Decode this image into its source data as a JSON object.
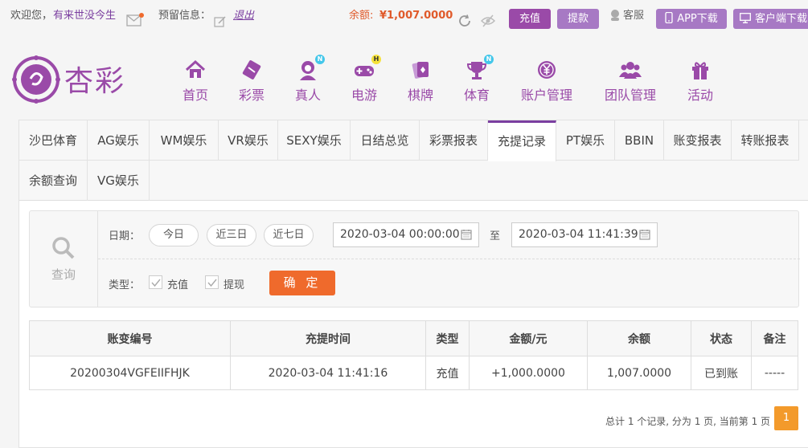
{
  "topbar": {
    "welcome": "欢迎您，",
    "username": "有来世没今生",
    "maintenance_label": "预留信息：",
    "logout": "退出",
    "balance_label": "余额:",
    "balance_value": "¥1,007.0000",
    "deposit": "充值",
    "withdraw": "提款",
    "customer_service": "客服",
    "app_download": "APP下载",
    "client_download": "客户端下载",
    "accent": "#9a4aa8"
  },
  "brand": {
    "logo_text": "杏彩"
  },
  "nav": [
    {
      "label": "首页",
      "icon": "home-icon"
    },
    {
      "label": "彩票",
      "icon": "ticket-icon"
    },
    {
      "label": "真人",
      "icon": "live-dealer-icon",
      "badge": "N"
    },
    {
      "label": "电游",
      "icon": "gamepad-icon",
      "badge": "H"
    },
    {
      "label": "棋牌",
      "icon": "cards-icon"
    },
    {
      "label": "体育",
      "icon": "trophy-icon",
      "badge": "N"
    },
    {
      "label": "账户管理",
      "icon": "yen-coin-icon"
    },
    {
      "label": "团队管理",
      "icon": "team-icon"
    },
    {
      "label": "活动",
      "icon": "gift-icon"
    }
  ],
  "tabs": [
    "沙巴体育",
    "AG娱乐",
    "WM娱乐",
    "VR娱乐",
    "SEXY娱乐",
    "日结总览",
    "彩票报表",
    "充提记录",
    "PT娱乐",
    "BBIN",
    "账变报表",
    "转账报表",
    "余额查询",
    "VG娱乐"
  ],
  "active_tab": "充提记录",
  "filter": {
    "query_label": "查询",
    "date_label": "日期：",
    "quick": [
      "今日",
      "近三日",
      "近七日"
    ],
    "date_from": "2020-03-04 00:00:00",
    "to_label": "至",
    "date_to": "2020-03-04 11:41:39",
    "type_label": "类型：",
    "types": [
      "充值",
      "提现"
    ],
    "confirm": "确 定"
  },
  "table": {
    "headers": [
      "账变编号",
      "充提时间",
      "类型",
      "金额/元",
      "余额",
      "状态",
      "备注"
    ],
    "rows": [
      {
        "id": "20200304VGFEIIFHJK",
        "time": "2020-03-04 11:41:16",
        "type": "充值",
        "amount": "+1,000.0000",
        "balance": "1,007.0000",
        "status": "已到账",
        "note": "-----"
      }
    ]
  },
  "pager": {
    "summary": "总计 1 个记录, 分为 1 页, 当前第 1 页",
    "current": "1"
  }
}
